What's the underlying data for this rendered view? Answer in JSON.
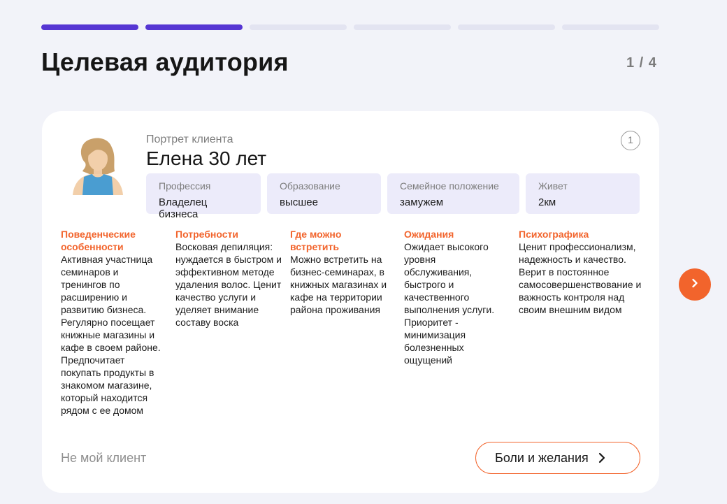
{
  "progress": {
    "total": 6,
    "completed": 2
  },
  "header": {
    "title": "Целевая аудитория",
    "counter": "1 / 4"
  },
  "card": {
    "subtitle": "Портрет клиента",
    "name": "Елена 30 лет",
    "number": "1",
    "info": [
      {
        "label": "Профессия",
        "value": "Владелец бизнеса"
      },
      {
        "label": "Образование",
        "value": "высшее"
      },
      {
        "label": "Семейное положение",
        "value": "замужем"
      },
      {
        "label": "Живет",
        "value": "2км"
      }
    ],
    "columns": [
      {
        "heading": "Поведенческие особенности",
        "text": "Активная участница семинаров и тренингов по расширению и развитию бизнеса. Регулярно посещает книжные магазины и кафе в своем районе. Предпочитает покупать продукты в знакомом магазине, который находится рядом с ее домом"
      },
      {
        "heading": "Потребности",
        "text": "Восковая депиляция: нуждается в быстром и эффективном методе удаления волос. Ценит качество услуги и уделяет внимание составу воска"
      },
      {
        "heading": "Где можно встретить",
        "text": "Можно встретить на бизнес-семинарах, в книжных магазинах и кафе на территории района проживания"
      },
      {
        "heading": "Ожидания",
        "text": "Ожидает высокого уровня обслуживания, быстрого и качественного выполнения услуги. Приоритет - минимизация болезненных ощущений"
      },
      {
        "heading": "Психографика",
        "text": "Ценит профессионализм, надежность и качество. Верит в постоянное самосовершенствование и важность контроля над своим внешним видом"
      }
    ],
    "not_mine_label": "Не мой клиент",
    "pains_button_label": "Боли и желания"
  },
  "colors": {
    "accent": "#f2642c",
    "progress_active": "#5636d3",
    "progress_inactive": "#e3e4f1",
    "info_bg": "#ecebfa"
  },
  "icons": {
    "avatar": "woman-avatar",
    "next": "chevron-right-icon"
  }
}
